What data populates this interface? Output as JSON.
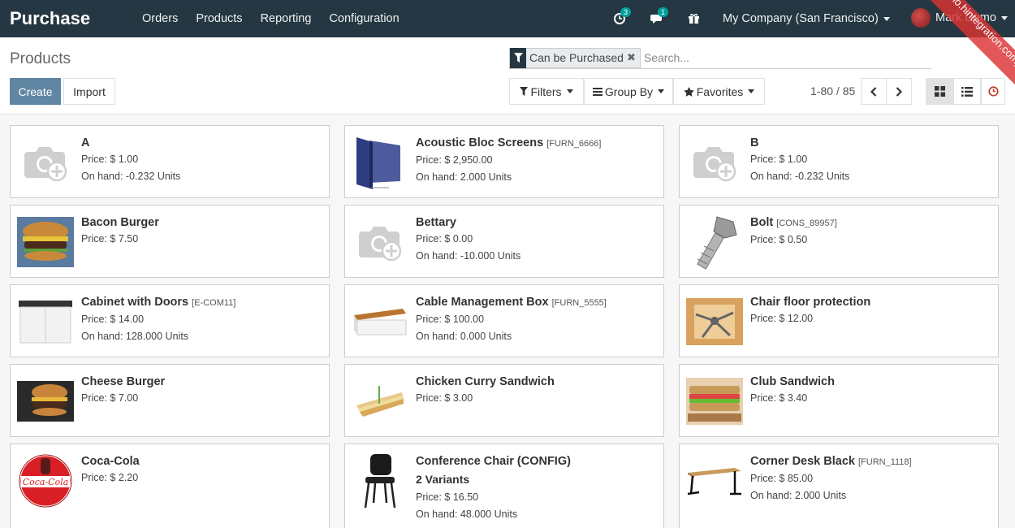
{
  "navbar": {
    "app_name": "Purchase",
    "menu": [
      "Orders",
      "Products",
      "Reporting",
      "Configuration"
    ],
    "activity_count": "3",
    "message_count": "1",
    "company": "My Company (San Francisco)",
    "user": "Mark Demo"
  },
  "ribbon": "(demo.hintegration.com) Sunpop Test",
  "control_panel": {
    "breadcrumb": "Products",
    "create_label": "Create",
    "import_label": "Import",
    "filter_facet": "Can be Purchased",
    "search_placeholder": "Search...",
    "filters_label": "Filters",
    "groupby_label": "Group By",
    "favorites_label": "Favorites",
    "pager": "1-80 / 85"
  },
  "products": [
    {
      "name": "A",
      "code": "",
      "variants": "",
      "price": "Price: $ 1.00",
      "onhand": "On hand: -0.232 Units",
      "image": "placeholder-camera-icon"
    },
    {
      "name": "Acoustic Bloc Screens",
      "code": "[FURN_6666]",
      "variants": "",
      "price": "Price: $ 2,950.00",
      "onhand": "On hand: 2.000 Units",
      "image": "acoustic-screens"
    },
    {
      "name": "B",
      "code": "",
      "variants": "",
      "price": "Price: $ 1.00",
      "onhand": "On hand: -0.232 Units",
      "image": "placeholder-camera-icon"
    },
    {
      "name": "Bacon Burger",
      "code": "",
      "variants": "",
      "price": "Price: $ 7.50",
      "onhand": "",
      "image": "bacon-burger"
    },
    {
      "name": "Bettary",
      "code": "",
      "variants": "",
      "price": "Price: $ 0.00",
      "onhand": "On hand: -10.000 Units",
      "image": "placeholder-camera-icon"
    },
    {
      "name": "Bolt",
      "code": "[CONS_89957]",
      "variants": "",
      "price": "Price: $ 0.50",
      "onhand": "",
      "image": "bolt"
    },
    {
      "name": "Cabinet with Doors",
      "code": "[E-COM11]",
      "variants": "",
      "price": "Price: $ 14.00",
      "onhand": "On hand: 128.000 Units",
      "image": "cabinet"
    },
    {
      "name": "Cable Management Box",
      "code": "[FURN_5555]",
      "variants": "",
      "price": "Price: $ 100.00",
      "onhand": "On hand: 0.000 Units",
      "image": "cable-box"
    },
    {
      "name": "Chair floor protection",
      "code": "",
      "variants": "",
      "price": "Price: $ 12.00",
      "onhand": "",
      "image": "chair-floor"
    },
    {
      "name": "Cheese Burger",
      "code": "",
      "variants": "",
      "price": "Price: $ 7.00",
      "onhand": "",
      "image": "cheese-burger"
    },
    {
      "name": "Chicken Curry Sandwich",
      "code": "",
      "variants": "",
      "price": "Price: $ 3.00",
      "onhand": "",
      "image": "sandwich"
    },
    {
      "name": "Club Sandwich",
      "code": "",
      "variants": "",
      "price": "Price: $ 3.40",
      "onhand": "",
      "image": "club-sandwich"
    },
    {
      "name": "Coca-Cola",
      "code": "",
      "variants": "",
      "price": "Price: $ 2.20",
      "onhand": "",
      "image": "coca-cola"
    },
    {
      "name": "Conference Chair (CONFIG)",
      "code": "",
      "variants": "2 Variants",
      "price": "Price: $ 16.50",
      "onhand": "On hand: 48.000 Units",
      "image": "conference-chair"
    },
    {
      "name": "Corner Desk Black",
      "code": "[FURN_1118]",
      "variants": "",
      "price": "Price: $ 85.00",
      "onhand": "On hand: 2.000 Units",
      "image": "corner-desk"
    }
  ]
}
